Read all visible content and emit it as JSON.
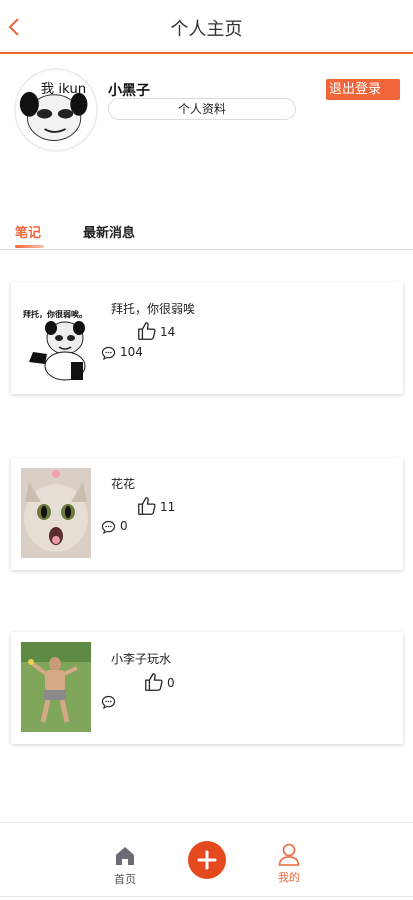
{
  "header": {
    "title": "个人主页"
  },
  "profile": {
    "username": "小黑子",
    "profile_button": "个人资料",
    "logout_button": "退出登录",
    "avatar_caption": "我 ikun"
  },
  "tabs": [
    {
      "label": "笔记",
      "active": true
    },
    {
      "label": "最新消息",
      "active": false
    }
  ],
  "notes": [
    {
      "title": "拜托，你很弱唉",
      "likes": "14",
      "comments": "104",
      "thumb_caption": "拜托，你很弱唉。"
    },
    {
      "title": "花花",
      "likes": "11",
      "comments": "0"
    },
    {
      "title": "小李子玩水",
      "likes": "0",
      "comments": ""
    }
  ],
  "bottom_nav": {
    "home_label": "首页",
    "mine_label": "我的"
  },
  "colors": {
    "accent": "#f0653a",
    "add_button": "#e54a1e"
  }
}
